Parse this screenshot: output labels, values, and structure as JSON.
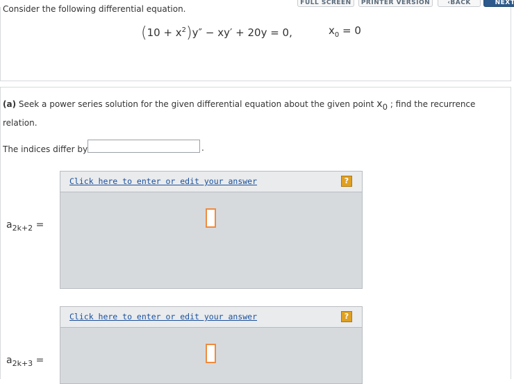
{
  "toolbar": {
    "full_screen": "FULL SCREEN",
    "printer_version": "PRINTER VERSION",
    "back": "BACK",
    "next": "NEXT"
  },
  "problem": {
    "intro": "Consider the following differential equation.",
    "equation_lhs_a": "10 + x",
    "equation_exp": "2",
    "equation_rest": "y″ − xy′ + 20y = 0,",
    "x0_label": "x",
    "x0_sub": "0",
    "x0_value": "= 0"
  },
  "part_a": {
    "label": "(a)",
    "text_before": "Seek a power series solution for the given differential equation about the given point",
    "x0": "x",
    "x0_sub": "0",
    "text_after": "; find the recurrence relation.",
    "indices_label": "The indices differ by",
    "indices_value": "",
    "period": "."
  },
  "answers": [
    {
      "link": "Click here to enter or edit your answer",
      "help": "?",
      "coef": "a",
      "coef_sub": "2k+2",
      "eq": "="
    },
    {
      "link": "Click here to enter or edit your answer",
      "help": "?",
      "coef": "a",
      "coef_sub": "2k+3",
      "eq": "="
    }
  ],
  "colors": {
    "link": "#1a4f9c",
    "help_icon": "#e0a020",
    "next_button": "#2c5a8c",
    "answer_area": "#d7dadd"
  }
}
